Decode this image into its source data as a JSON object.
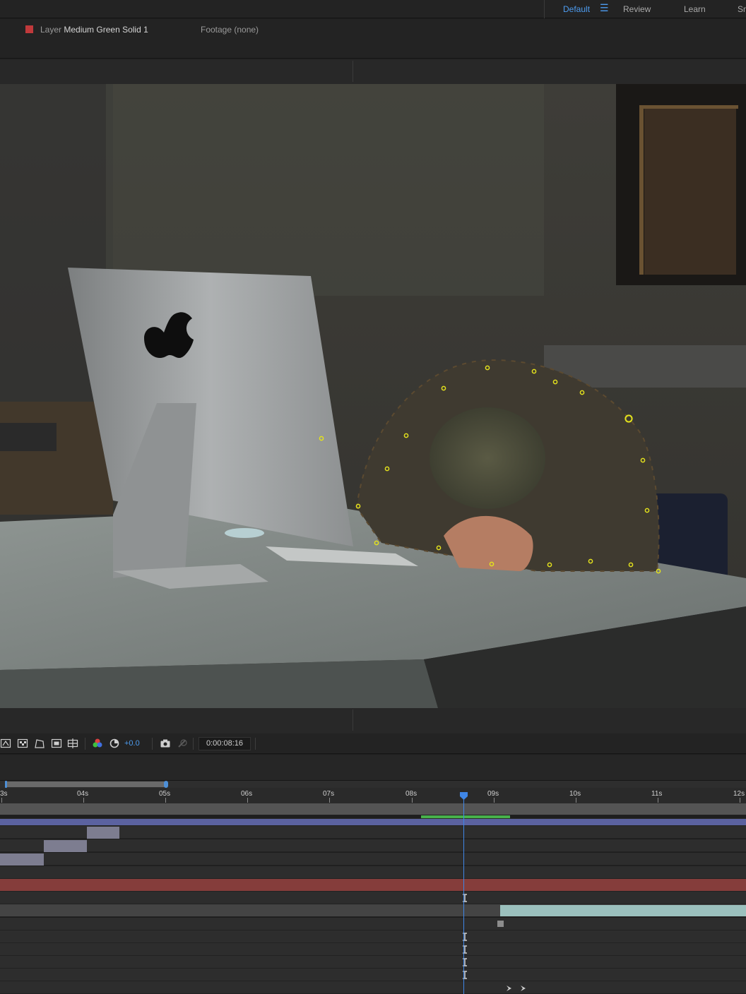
{
  "workspace": {
    "tabs": [
      "Default",
      "Review",
      "Learn",
      "Sm"
    ],
    "active": "Default",
    "accent_color": "#4d9cf0"
  },
  "layer_panel": {
    "prefix": "Layer",
    "layer_name": "Medium Green Solid 1",
    "footage_tab": "Footage (none)",
    "label_color": "#c0393b"
  },
  "viewer_toolbar": {
    "icons": [
      "roi-icon",
      "transparency-grid-icon",
      "mask-path-icon",
      "title-safe-icon",
      "snapshot-region-icon",
      "color-channels-icon",
      "reset-exposure-icon",
      "camera-snapshot-icon",
      "show-snapshot-icon"
    ],
    "exposure": "+0.0",
    "timecode": "0:00:08:16"
  },
  "timeline": {
    "ruler_labels": [
      "3s",
      "04s",
      "05s",
      "06s",
      "07s",
      "08s",
      "09s",
      "10s",
      "11s",
      "12s"
    ],
    "playhead_color": "#3f86e6",
    "cache_color": "#47b04b",
    "tracks": [
      {
        "kind": "solid-bar",
        "color": "#5b62a0"
      },
      {
        "kind": "segment",
        "color": "#7d7d90"
      },
      {
        "kind": "segment",
        "color": "#7d7d90"
      },
      {
        "kind": "segment",
        "color": "#7d7d90"
      },
      {
        "kind": "empty"
      },
      {
        "kind": "solid-bar",
        "color": "#853d3b"
      },
      {
        "kind": "keyframe"
      },
      {
        "kind": "clip",
        "color": "#9bc0bd"
      },
      {
        "kind": "keyframe-square"
      },
      {
        "kind": "keyframe"
      },
      {
        "kind": "keyframe"
      },
      {
        "kind": "keyframe"
      },
      {
        "kind": "keyframe"
      },
      {
        "kind": "nav-arrows"
      }
    ]
  }
}
